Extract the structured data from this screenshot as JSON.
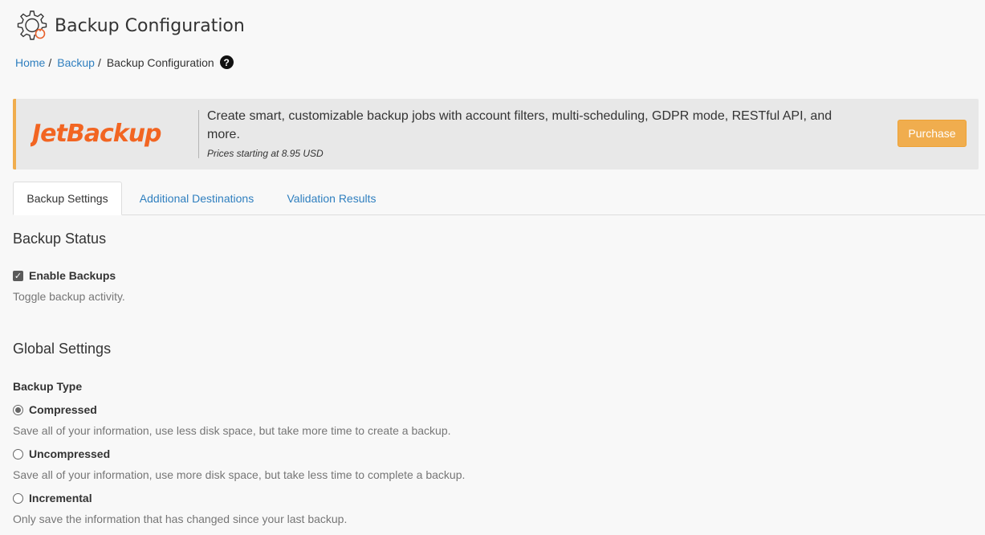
{
  "header": {
    "title": "Backup Configuration",
    "icon": "gear-backup-icon"
  },
  "breadcrumb": {
    "items": [
      "Home",
      "Backup"
    ],
    "current": "Backup Configuration",
    "help_icon": "question-circle-icon",
    "help_glyph": "?"
  },
  "promo": {
    "brand": "JetBackup",
    "description": "Create smart, customizable backup jobs with account filters, multi-scheduling, GDPR mode, RESTful API, and more.",
    "price_note": "Prices starting at 8.95 USD",
    "button_label": "Purchase",
    "accent_color": "#f0ad4e",
    "brand_color": "#f26522"
  },
  "tabs": [
    {
      "label": "Backup Settings",
      "active": true
    },
    {
      "label": "Additional Destinations",
      "active": false
    },
    {
      "label": "Validation Results",
      "active": false
    }
  ],
  "backup_status": {
    "title": "Backup Status",
    "enable_label": "Enable Backups",
    "enable_checked": true,
    "enable_help": "Toggle backup activity."
  },
  "global_settings": {
    "title": "Global Settings",
    "backup_type_label": "Backup Type",
    "options": [
      {
        "label": "Compressed",
        "help": "Save all of your information, use less disk space, but take more time to create a backup.",
        "selected": true
      },
      {
        "label": "Uncompressed",
        "help": "Save all of your information, use more disk space, but take less time to complete a backup.",
        "selected": false
      },
      {
        "label": "Incremental",
        "help": "Only save the information that has changed since your last backup.",
        "selected": false
      }
    ]
  }
}
